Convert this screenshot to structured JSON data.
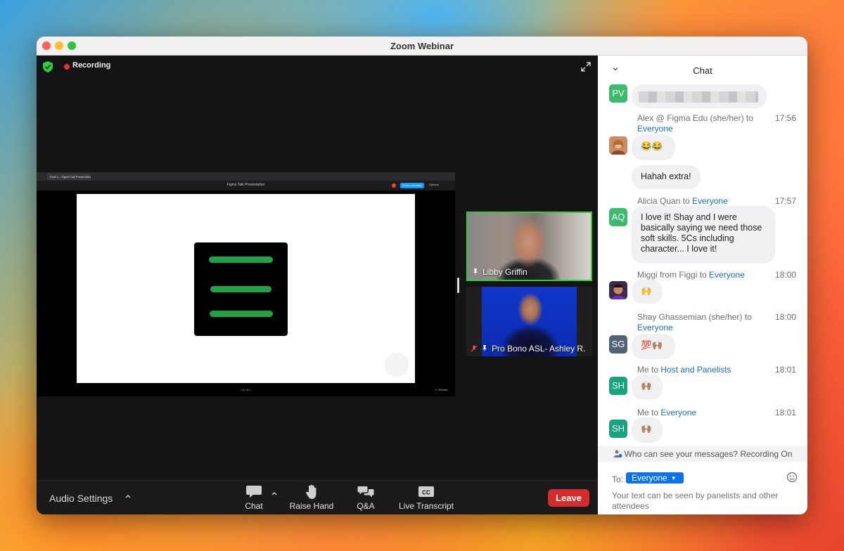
{
  "window": {
    "title": "Zoom Webinar"
  },
  "recording": {
    "label": "Recording"
  },
  "shared_screen": {
    "tab_label": "Draft 1 – Figma Talk Presentation",
    "file_title": "Figma Talk Presentation",
    "share_button": "Share prototype",
    "options_label": "Options",
    "pager": "‹ 6 / 10 ›",
    "reset_label": "↩ Restart"
  },
  "participants": [
    {
      "name": "Libby Griffin",
      "active_speaker": true
    },
    {
      "name": "Pro Bono ASL- Ashley R.",
      "muted": true
    }
  ],
  "toolbar": {
    "audio_settings": "Audio Settings",
    "chat": "Chat",
    "raise_hand": "Raise Hand",
    "qa": "Q&A",
    "live_transcript": "Live Transcript",
    "cc_badge": "CC",
    "leave": "Leave"
  },
  "chat": {
    "title": "Chat",
    "messages": [
      {
        "avatar": "PV",
        "sender": "",
        "to": "",
        "time": "",
        "text": "",
        "blurred": true
      },
      {
        "avatar": "photo",
        "sender": "Alex @ Figma Edu (she/her) to",
        "to": "Everyone",
        "time": "17:56",
        "text": "😂😂"
      },
      {
        "avatar": "",
        "sender": "",
        "to": "",
        "time": "",
        "text": "Hahah extra!"
      },
      {
        "avatar": "AQ",
        "sender": "Alicia Quan to",
        "to": "Everyone",
        "time": "17:57",
        "text": "I love it! Shay and I were basically saying we need those soft skills. 5Cs including character... I love it!"
      },
      {
        "avatar": "photo",
        "sender": "Miggi from Figgi to",
        "to": "Everyone",
        "time": "18:00",
        "text": "🙌"
      },
      {
        "avatar": "SG",
        "sender": "Shay Ghassemian (she/her) to",
        "to": "Everyone",
        "time": "18:00",
        "text": "💯🙌🏽"
      },
      {
        "avatar": "SH",
        "sender": "Me to",
        "to": "Host and Panelists",
        "time": "18:01",
        "text": "🙌🏽"
      },
      {
        "avatar": "SH",
        "sender": "Me to",
        "to": "Everyone",
        "time": "18:01",
        "text": "🙌🏽"
      }
    ],
    "who_can_see": "Who can see your messages? Recording On",
    "to_label": "To:",
    "to_value": "Everyone",
    "input_placeholder": "Your text can be seen by panelists and other attendees"
  },
  "colors": {
    "accent_blue": "#0e72ed",
    "leave_red": "#d42b2b",
    "active_speaker_green": "#2ecc40",
    "recording_red": "#e8322e"
  },
  "icons": [
    "shield-icon",
    "expand-icon",
    "chevron-up-icon",
    "chat-icon",
    "raise-hand-icon",
    "qa-icon",
    "cc-icon",
    "chevron-down-icon",
    "emoji-icon",
    "people-icon",
    "pin-icon",
    "mic-muted-icon"
  ]
}
